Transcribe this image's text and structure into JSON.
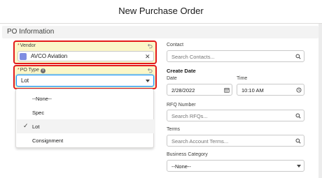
{
  "modal": {
    "title": "New Purchase Order"
  },
  "section": {
    "title": "PO Information"
  },
  "vendor": {
    "label": "Vendor",
    "required_mark": "*",
    "value": "AVCO Aviation",
    "icon": "vendor-record-icon"
  },
  "po_type": {
    "label": "PO Type",
    "required_mark": "*",
    "value": "Lot",
    "info_icon": "i",
    "options": [
      "--None--",
      "Spec",
      "Lot",
      "Consignment"
    ],
    "selected": "Lot",
    "check": "✓"
  },
  "contact": {
    "label": "Contact",
    "placeholder": "Search Contacts..."
  },
  "create_date": {
    "heading": "Create Date",
    "date_label": "Date",
    "date_value": "2/28/2022",
    "time_label": "Time",
    "time_value": "10:10 AM"
  },
  "rfq": {
    "label": "RFQ Number",
    "placeholder": "Search RFQs..."
  },
  "terms": {
    "label": "Terms",
    "placeholder": "Search Account Terms..."
  },
  "business_category": {
    "label": "Business Category",
    "value": "--None--"
  },
  "colors": {
    "highlight_border": "#e31b1b",
    "highlight_fill": "#fbf7c8",
    "focus_blue": "#1b96ff",
    "vendor_icon": "#7f8de1"
  }
}
